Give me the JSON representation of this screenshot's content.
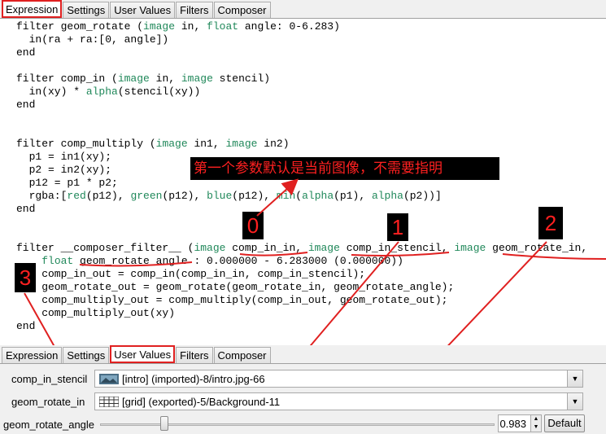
{
  "top_tabs": [
    "Expression",
    "Settings",
    "User Values",
    "Filters",
    "Composer"
  ],
  "bottom_tabs": [
    "Expression",
    "Settings",
    "User Values",
    "Filters",
    "Composer"
  ],
  "code": {
    "line1_a": "filter geom_rotate (",
    "line1_b": "image",
    "line1_c": " in, ",
    "line1_d": "float",
    "line1_e": " angle: 0-6.283)",
    "line2": "  in(ra + ra:[0, angle])",
    "line3": "end",
    "line4_a": "filter comp_in (",
    "line4_b": "image",
    "line4_c": " in, ",
    "line4_d": "image",
    "line4_e": " stencil)",
    "line5_a": "  in(xy) * ",
    "line5_b": "alpha",
    "line5_c": "(stencil(xy))",
    "line6": "end",
    "line7_a": "filter comp_multiply (",
    "line7_b": "image",
    "line7_c": " in1, ",
    "line7_d": "image",
    "line7_e": " in2)",
    "line8": "  p1 = in1(xy);",
    "line9": "  p2 = in2(xy);",
    "line10": "  p12 = p1 * p2;",
    "line11_a": "  rgba:[",
    "line11_b": "red",
    "line11_c": "(p12), ",
    "line11_d": "green",
    "line11_e": "(p12), ",
    "line11_f": "blue",
    "line11_g": "(p12), ",
    "line11_h": "min",
    "line11_i": "(",
    "line11_j": "alpha",
    "line11_k": "(p1), ",
    "line11_l": "alpha",
    "line11_m": "(p2))]",
    "line12": "end",
    "line13_a": "filter __composer_filter__ (",
    "line13_b": "image",
    "line13_c": " comp_in_in, ",
    "line13_d": "image",
    "line13_e": " comp_in_stencil, ",
    "line13_f": "image",
    "line13_g": " geom_rotate_in,",
    "line14_a": "    ",
    "line14_b": "float",
    "line14_c": " geom_rotate_angle : 0.000000 - 6.283000 (0.000000))",
    "line15": "    comp_in_out = comp_in(comp_in_in, comp_in_stencil);",
    "line16": "    geom_rotate_out = geom_rotate(geom_rotate_in, geom_rotate_angle);",
    "line17": "    comp_multiply_out = comp_multiply(comp_in_out, geom_rotate_out);",
    "line18": "    comp_multiply_out(xy)",
    "line19": "end"
  },
  "annotations": {
    "note": "第一个参数默认是当前图像，不需要指明",
    "num0": "0",
    "num1": "1",
    "num2": "2",
    "num3": "3",
    "color": "#ff2020"
  },
  "user_values": {
    "row1_label": "comp_in_stencil",
    "row1_value": "[intro] (imported)-8/intro.jpg-66",
    "row2_label": "geom_rotate_in",
    "row2_value": "[grid] (exported)-5/Background-11",
    "row3_label": "geom_rotate_angle",
    "row3_value": "0.983",
    "row3_fraction": 0.156,
    "default_button": "Default"
  }
}
